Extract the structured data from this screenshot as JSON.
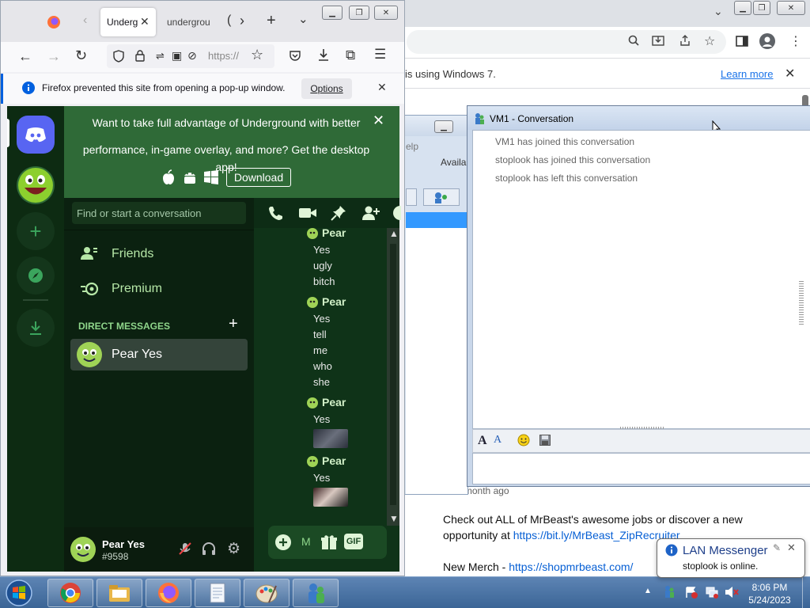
{
  "chrome": {
    "infobar_text": "is using Windows 7.",
    "learn_more": "Learn more",
    "yt_meta": "s • 1 month ago",
    "desc_line1": "Check out ALL of MrBeast's awesome jobs or discover a new",
    "desc_line2_prefix": "opportunity at ",
    "desc_link1": "https://bit.ly/MrBeast_ZipRecruiter",
    "desc_line3_prefix": "New Merch - ",
    "desc_link2": "https://shopmrbeast.com/"
  },
  "bg_window": {
    "menu_help": "elp",
    "label_avail": "Availa"
  },
  "lan_messenger": {
    "title": "VM1 - Conversation",
    "messages": [
      "VM1 has joined this conversation",
      "stoplook has joined this conversation",
      "stoplook has left this conversation"
    ]
  },
  "firefox": {
    "tab_active": "Underg",
    "tab_2": "undergrou",
    "url_text": "https://",
    "notice": "Firefox prevented this site from opening a pop-up window.",
    "options_label": "Options"
  },
  "discord": {
    "banner_line1": "Want to take full advantage of Underground with better",
    "banner_line2": "performance, in-game overlay, and more? Get the desktop app!",
    "download_label": "Download",
    "search_placeholder": "Find or start a conversation",
    "friends_label": "Friends",
    "premium_label": "Premium",
    "dm_header": "DIRECT MESSAGES",
    "dm_user": "Pear Yes",
    "messages": [
      {
        "name": "Pear",
        "lines": [
          "Yes",
          "ugly",
          "bitch"
        ]
      },
      {
        "name": "Pear",
        "lines": [
          "Yes",
          "tell",
          "me",
          "who",
          "she"
        ]
      },
      {
        "name": "Pear",
        "lines": [
          "Yes"
        ]
      },
      {
        "name": "Pear",
        "lines": [
          "Yes"
        ]
      }
    ],
    "user_name": "Pear Yes",
    "user_tag": "#9598",
    "gif_label": "GIF",
    "compose_stub": "M"
  },
  "taskbar": {
    "time": "8:06 PM",
    "date": "5/24/2023"
  },
  "notification": {
    "title": "LAN Messenger",
    "body": "stoplook is online."
  }
}
